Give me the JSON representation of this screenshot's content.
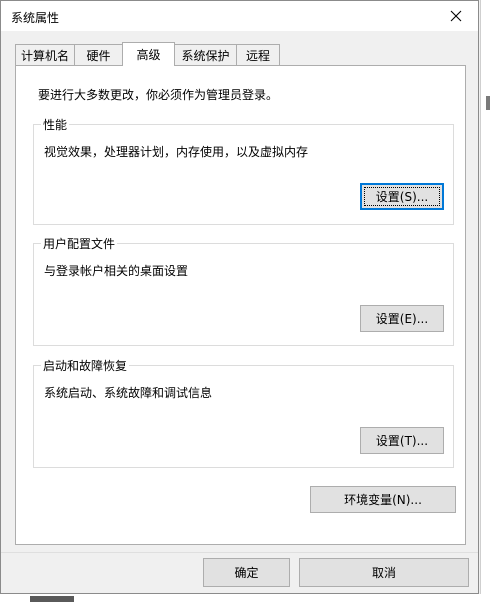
{
  "window": {
    "title": "系统属性",
    "close_glyph": "✕"
  },
  "tabs": [
    {
      "label": "计算机名",
      "active": false
    },
    {
      "label": "硬件",
      "active": false
    },
    {
      "label": "高级",
      "active": true
    },
    {
      "label": "系统保护",
      "active": false
    },
    {
      "label": "远程",
      "active": false
    }
  ],
  "advanced": {
    "intro": "要进行大多数更改，你必须作为管理员登录。",
    "performance": {
      "title": "性能",
      "desc": "视觉效果，处理器计划，内存使用，以及虚拟内存",
      "button": "设置(S)..."
    },
    "profiles": {
      "title": "用户配置文件",
      "desc": "与登录帐户相关的桌面设置",
      "button": "设置(E)..."
    },
    "startup": {
      "title": "启动和故障恢复",
      "desc": "系统启动、系统故障和调试信息",
      "button": "设置(T)..."
    },
    "env_button": "环境变量(N)..."
  },
  "footer": {
    "ok": "确定",
    "cancel": "取消"
  },
  "colors": {
    "focus_border": "#0078d7",
    "button_face": "#e1e1e1"
  }
}
